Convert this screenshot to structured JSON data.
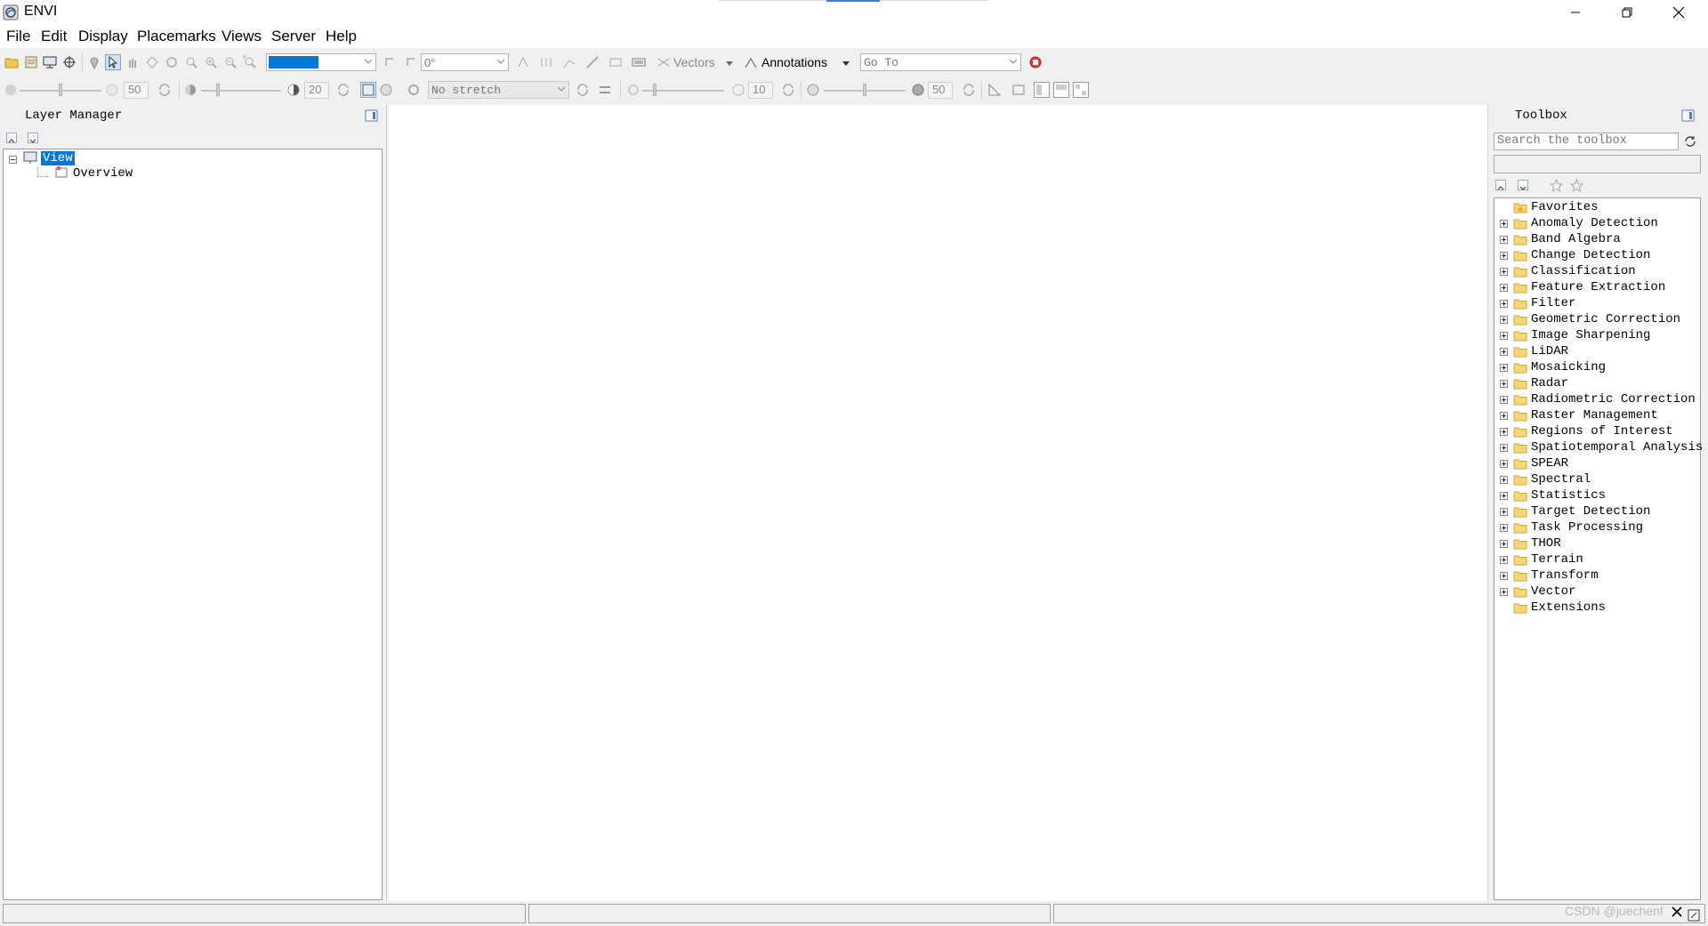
{
  "window": {
    "title": "ENVI"
  },
  "menu": [
    "File",
    "Edit",
    "Display",
    "Placemarks",
    "Views",
    "Server",
    "Help"
  ],
  "toolbar1": {
    "zoom_combo": "",
    "rotation": "0°",
    "vectors_label": "Vectors",
    "annotations_label": "Annotations",
    "goto_placeholder": "Go To"
  },
  "toolbar2": {
    "brightness": "50",
    "contrast": "20",
    "stretch": "No stretch",
    "sharpen": "10",
    "transparency": "50"
  },
  "layer_manager": {
    "title": "Layer Manager",
    "items": [
      {
        "label": "View",
        "selected": true
      },
      {
        "label": "Overview"
      }
    ]
  },
  "toolbox": {
    "title": "Toolbox",
    "search_placeholder": "Search the toolbox",
    "items": [
      "Favorites",
      "Anomaly Detection",
      "Band Algebra",
      "Change Detection",
      "Classification",
      "Feature Extraction",
      "Filter",
      "Geometric Correction",
      "Image Sharpening",
      "LiDAR",
      "Mosaicking",
      "Radar",
      "Radiometric Correction",
      "Raster Management",
      "Regions of Interest",
      "Spatiotemporal Analysis",
      "SPEAR",
      "Spectral",
      "Statistics",
      "Target Detection",
      "Task Processing",
      "THOR",
      "Terrain",
      "Transform",
      "Vector",
      "Extensions"
    ]
  },
  "watermark": "CSDN @juechenf",
  "colors": {
    "selection": "#0078d7",
    "folder": "#f5d67a",
    "border": "#9a9a9a"
  }
}
